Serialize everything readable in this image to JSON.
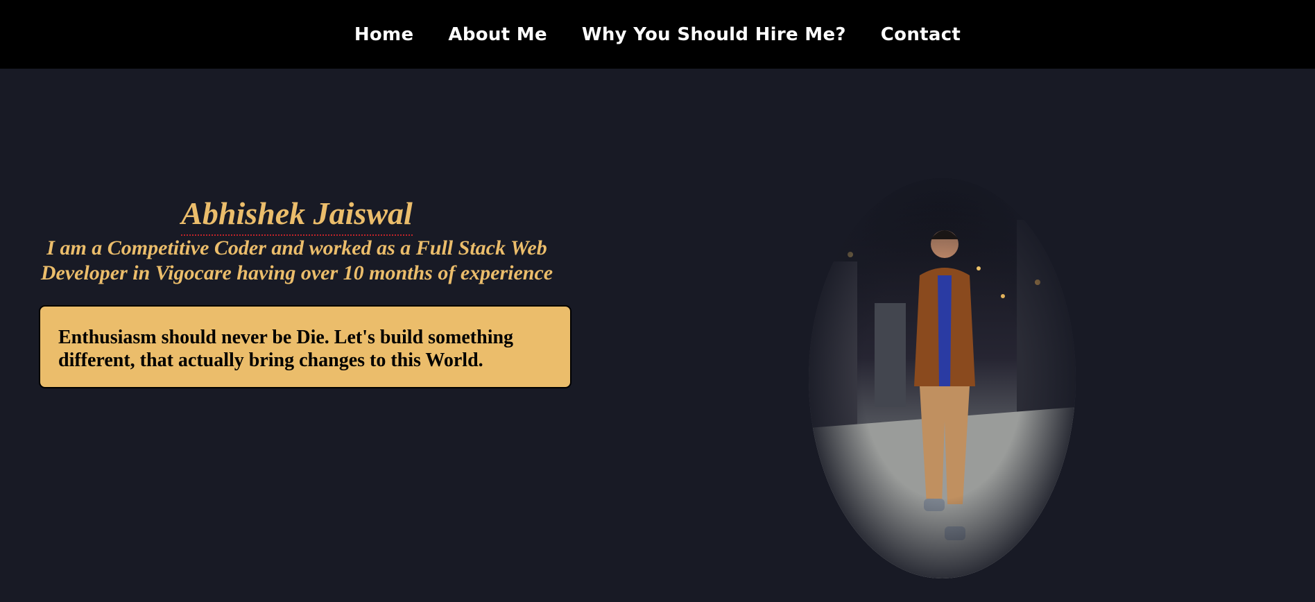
{
  "nav": {
    "items": [
      {
        "label": "Home"
      },
      {
        "label": "About Me"
      },
      {
        "label": "Why You Should Hire Me?"
      },
      {
        "label": "Contact"
      }
    ]
  },
  "hero": {
    "name": "Abhishek Jaiswal",
    "subtitle": "I am a Competitive Coder and worked as a Full Stack Web Developer in Vigocare having over 10 months of experience",
    "quote": "Enthusiasm should never be Die. Let's build something different, that actually bring changes to this World."
  },
  "colors": {
    "background": "#181a25",
    "navbar": "#000000",
    "accent": "#ebbd6b"
  }
}
